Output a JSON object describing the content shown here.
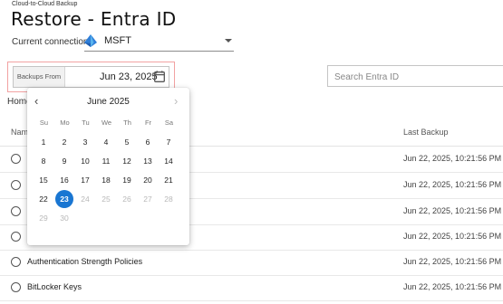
{
  "app": {
    "eyebrow": "Cloud-to-Cloud Backup",
    "title": "Restore - Entra ID"
  },
  "connection": {
    "label": "Current connection:",
    "value": "MSFT",
    "icon": "azure-ad-icon"
  },
  "backups_from": {
    "label": "Backups From",
    "value": "Jun 23, 2025",
    "icon": "calendar-icon"
  },
  "search": {
    "placeholder": "Search Entra ID"
  },
  "breadcrumb": {
    "label": "Home"
  },
  "table": {
    "columns": [
      "Name",
      "Last Backup"
    ],
    "rows": [
      {
        "name": "",
        "last_backup": "Jun 22, 2025, 10:21:56 PM"
      },
      {
        "name": "",
        "last_backup": "Jun 22, 2025, 10:21:56 PM"
      },
      {
        "name": "",
        "last_backup": "Jun 22, 2025, 10:21:56 PM"
      },
      {
        "name": "",
        "last_backup": "Jun 22, 2025, 10:21:56 PM"
      },
      {
        "name": "Authentication Strength Policies",
        "last_backup": "Jun 22, 2025, 10:21:56 PM"
      },
      {
        "name": "BitLocker Keys",
        "last_backup": "Jun 22, 2025, 10:21:56 PM"
      }
    ]
  },
  "calendar": {
    "month": "June 2025",
    "prev_icon": "chevron-left-icon",
    "next_icon": "chevron-right-icon",
    "weekdays": [
      "Su",
      "Mo",
      "Tu",
      "We",
      "Th",
      "Fr",
      "Sa"
    ],
    "weeks": [
      [
        "1",
        "2",
        "3",
        "4",
        "5",
        "6",
        "7"
      ],
      [
        "8",
        "9",
        "10",
        "11",
        "12",
        "13",
        "14"
      ],
      [
        "15",
        "16",
        "17",
        "18",
        "19",
        "20",
        "21"
      ],
      [
        "22",
        "23",
        "24",
        "25",
        "26",
        "27",
        "28"
      ],
      [
        "29",
        "30",
        "",
        "",
        "",
        "",
        ""
      ]
    ],
    "selected_day": "23",
    "disabled_days": [
      "24",
      "25",
      "26",
      "27",
      "28",
      "29",
      "30"
    ],
    "accent_color": "#1976d2"
  }
}
